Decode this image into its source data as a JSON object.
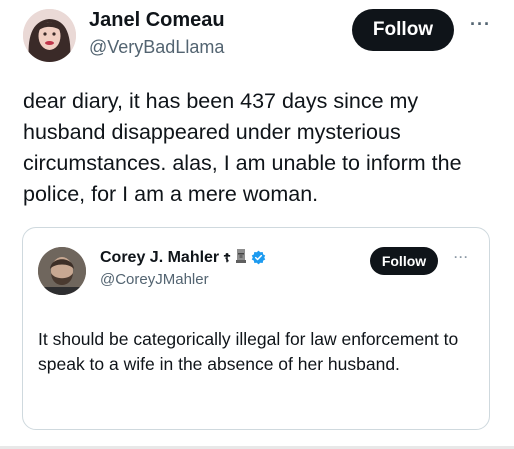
{
  "tweet": {
    "author_name": "Janel Comeau",
    "author_handle": "@VeryBadLlama",
    "follow_label": "Follow",
    "more_label": "···",
    "text": "dear diary, it has been 437 days since my husband disappeared under mysterious circumstances. alas, I am unable to inform the police, for I am a mere woman."
  },
  "quoted_tweet": {
    "author_name": "Corey J. Mahler",
    "author_handle": "@CoreyJMahler",
    "name_symbols": [
      "orthodox-cross-icon",
      "moai-icon",
      "verified-badge-icon"
    ],
    "follow_label": "Follow",
    "more_label": "···",
    "text": "It should be categorically illegal for law enforcement to speak to a wife in the absence of her husband."
  },
  "colors": {
    "text": "#0f1419",
    "secondary": "#536471",
    "button": "#0f1419",
    "verified": "#1d9bf0",
    "border": "#cfd9de"
  }
}
